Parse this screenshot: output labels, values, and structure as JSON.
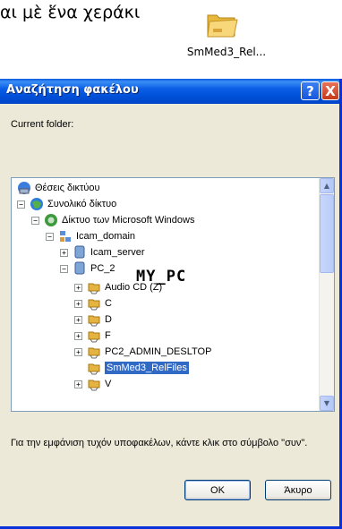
{
  "document": {
    "text": "αι μὲ ἕνα χεράκι"
  },
  "desktop_icon": {
    "label": "SmMed3_Rel...",
    "icon": "folder-icon"
  },
  "dialog": {
    "title": "Αναζήτηση φακέλου",
    "help_label": "?",
    "close_label": "X",
    "current_folder_label": "Current folder:",
    "tree": [
      {
        "label": "Θέσεις δικτύου",
        "icon": "network-places-icon",
        "expander": "none"
      },
      {
        "label": "Συνολικό δίκτυο",
        "icon": "globe-icon",
        "expander": "minus"
      },
      {
        "label": "Δίκτυο των Microsoft Windows",
        "icon": "windows-network-icon",
        "expander": "minus"
      },
      {
        "label": "Icam_domain",
        "icon": "domain-icon",
        "expander": "minus"
      },
      {
        "label": "Icam_server",
        "icon": "computer-icon",
        "expander": "plus"
      },
      {
        "label": "PC_2",
        "icon": "computer-icon",
        "expander": "minus"
      },
      {
        "label": "Audio CD (Z)",
        "icon": "shared-drive-icon",
        "expander": "plus"
      },
      {
        "label": "C",
        "icon": "shared-drive-icon",
        "expander": "plus"
      },
      {
        "label": "D",
        "icon": "shared-drive-icon",
        "expander": "plus"
      },
      {
        "label": "F",
        "icon": "shared-drive-icon",
        "expander": "plus"
      },
      {
        "label": "PC2_ADMIN_DESLTOP",
        "icon": "shared-folder-icon",
        "expander": "plus"
      },
      {
        "label": "SmMed3_RelFiles",
        "icon": "shared-folder-icon",
        "expander": "none",
        "selected": true
      },
      {
        "label": "V",
        "icon": "shared-drive-icon",
        "expander": "plus"
      }
    ],
    "overlay_label": "MY_PC",
    "hint": "Για την εμφάνιση τυχόν υποφακέλων, κάντε κλικ στο σύμβολο \"συν\".",
    "ok_label": "OK",
    "cancel_label": "Άκυρο",
    "colors": {
      "title_bar": "#0054e3",
      "selection": "#316ac5",
      "dialog_bg": "#ece9d8"
    }
  }
}
